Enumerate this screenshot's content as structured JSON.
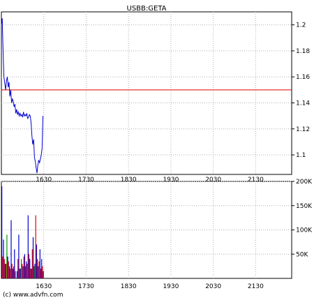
{
  "title": "USBB:GETA",
  "copyright": "(c) www.advfn.com",
  "colors": {
    "background": "#ffffff",
    "frame": "#000000",
    "grid": "#b0b0b0",
    "price_line": "#0000cc",
    "reference_line": "#dd0000",
    "volume_blue": "#0000cc",
    "volume_red": "#dd0000",
    "volume_green": "#009900"
  },
  "chart_data": [
    {
      "type": "line",
      "title": "USBB:GETA",
      "xlabel": "",
      "ylabel": "",
      "x_ticks": [
        "1630",
        "1730",
        "1830",
        "1930",
        "2030",
        "2130"
      ],
      "y_ticks": [
        "1.2",
        "1.18",
        "1.16",
        "1.14",
        "1.12",
        "1.1"
      ],
      "ylim": [
        1.085,
        1.21
      ],
      "xlim": [
        1530,
        2215
      ],
      "grid": true,
      "reference_line": 1.15,
      "series": [
        {
          "x": [
            1530,
            1532,
            1534,
            1536,
            1538,
            1540,
            1542,
            1544,
            1546,
            1548,
            1550,
            1552,
            1554,
            1556,
            1558,
            1560,
            1562,
            1564,
            1566,
            1568,
            1570,
            1572,
            1574,
            1576,
            1578,
            1580,
            1582,
            1584,
            1586,
            1588,
            1590,
            1592,
            1594,
            1596,
            1598,
            1600,
            1602,
            1604,
            1606,
            1608,
            1610,
            1612,
            1614,
            1616,
            1618,
            1620,
            1622,
            1624,
            1626,
            1628
          ],
          "y": [
            1.2,
            1.205,
            1.18,
            1.16,
            1.155,
            1.15,
            1.157,
            1.16,
            1.152,
            1.156,
            1.145,
            1.15,
            1.14,
            1.143,
            1.141,
            1.137,
            1.139,
            1.132,
            1.135,
            1.131,
            1.133,
            1.13,
            1.132,
            1.13,
            1.131,
            1.129,
            1.133,
            1.13,
            1.131,
            1.13,
            1.132,
            1.128,
            1.129,
            1.131,
            1.13,
            1.125,
            1.115,
            1.108,
            1.112,
            1.098,
            1.095,
            1.09,
            1.086,
            1.092,
            1.096,
            1.094,
            1.097,
            1.1,
            1.105,
            1.13
          ]
        }
      ]
    },
    {
      "type": "bar",
      "title": "",
      "xlabel": "",
      "ylabel": "",
      "x_ticks": [
        "1630",
        "1730",
        "1830",
        "1930",
        "2030",
        "2130"
      ],
      "y_ticks": [
        "200K",
        "150K",
        "100K",
        "50K"
      ],
      "ylim": [
        0,
        200000
      ],
      "xlim": [
        1530,
        2215
      ],
      "grid": true,
      "series": [
        {
          "name": "",
          "color": "blue",
          "x": [
            1531,
            1535,
            1539,
            1545,
            1549,
            1553,
            1557,
            1561,
            1567,
            1571,
            1575,
            1581,
            1585,
            1589,
            1593,
            1597,
            1601,
            1605,
            1609,
            1613,
            1617,
            1621,
            1625,
            1629
          ],
          "y": [
            190000,
            80000,
            30000,
            45000,
            25000,
            120000,
            20000,
            60000,
            15000,
            90000,
            20000,
            25000,
            50000,
            35000,
            130000,
            40000,
            20000,
            85000,
            30000,
            70000,
            25000,
            60000,
            40000,
            15000
          ]
        },
        {
          "name": "",
          "color": "red",
          "x": [
            1533,
            1537,
            1541,
            1547,
            1551,
            1555,
            1559,
            1563,
            1569,
            1573,
            1579,
            1583,
            1587,
            1591,
            1595,
            1599,
            1603,
            1607,
            1611,
            1615,
            1619,
            1623,
            1627
          ],
          "y": [
            45000,
            40000,
            30000,
            35000,
            20000,
            30000,
            25000,
            15000,
            40000,
            20000,
            30000,
            45000,
            25000,
            30000,
            50000,
            20000,
            60000,
            25000,
            130000,
            40000,
            35000,
            20000,
            25000
          ]
        },
        {
          "name": "",
          "color": "green",
          "x": [
            1543,
            1577,
            1607
          ],
          "y": [
            90000,
            40000,
            25000
          ]
        }
      ]
    }
  ]
}
